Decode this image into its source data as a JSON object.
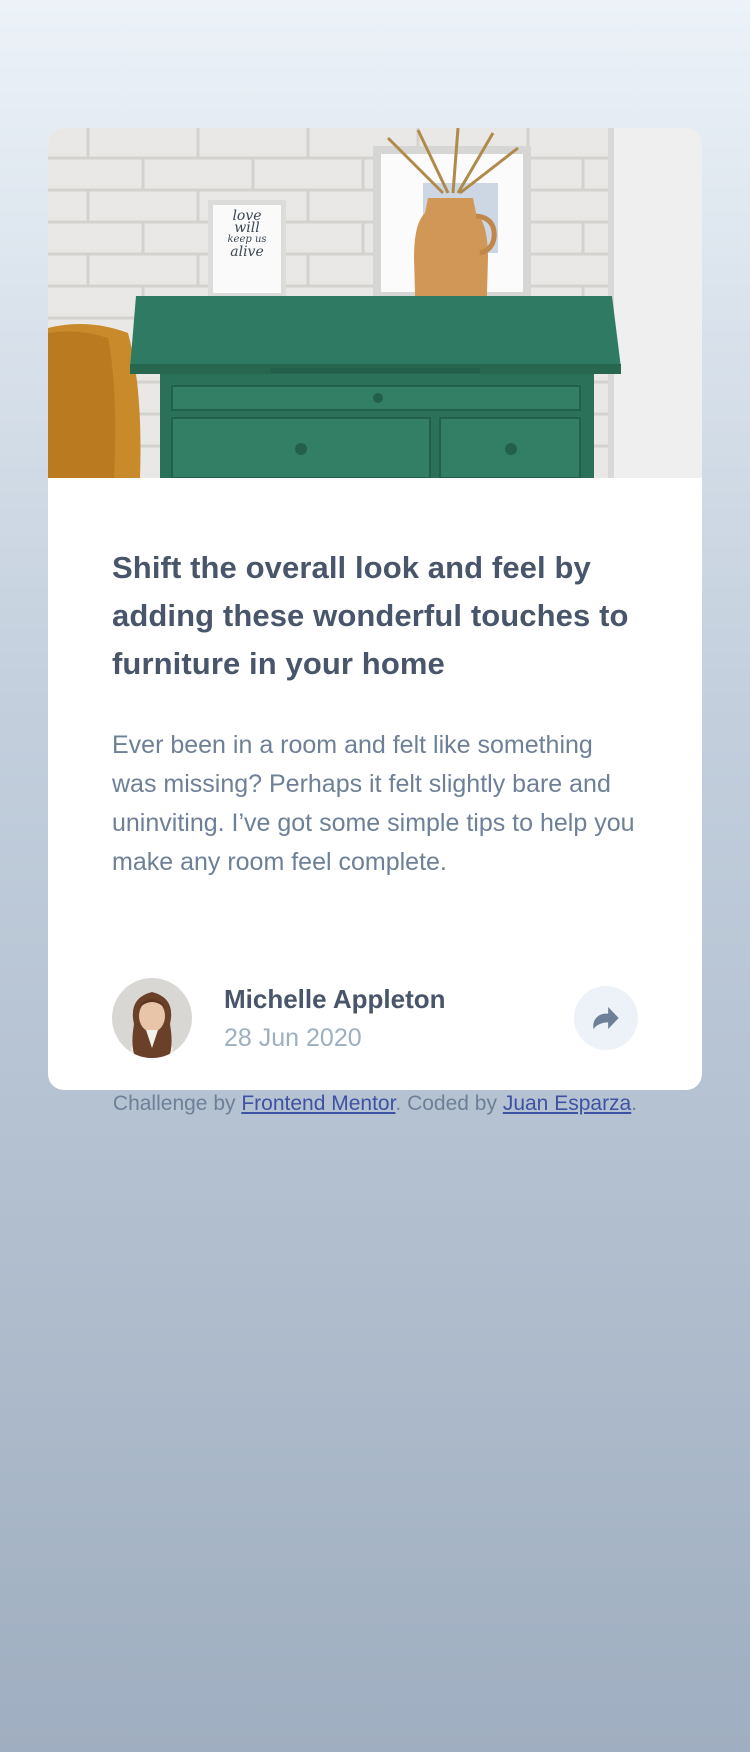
{
  "article": {
    "title": "Shift the overall look and feel by adding these wonderful touches to furniture in your home",
    "description": "Ever been in a room and felt like something was missing? Perhaps it felt slightly bare and uninviting. I’ve got some simple tips to help you make any room feel complete.",
    "hero_frame_text": [
      "love",
      "will",
      "keep us",
      "alive"
    ]
  },
  "author": {
    "name": "Michelle Appleton",
    "date": "28 Jun 2020"
  },
  "share": {
    "icon": "share-icon"
  },
  "attribution": {
    "prefix": "Challenge by ",
    "link1": "Frontend Mentor",
    "middle": ". Coded by ",
    "link2": "Juan Esparza",
    "suffix": "."
  },
  "colors": {
    "heading": "#48556a",
    "body_text": "#6e8098",
    "muted": "#9eafc2",
    "light": "#ecf2f8",
    "link": "#3e52a3",
    "drawer_green": "#2f7a62"
  }
}
